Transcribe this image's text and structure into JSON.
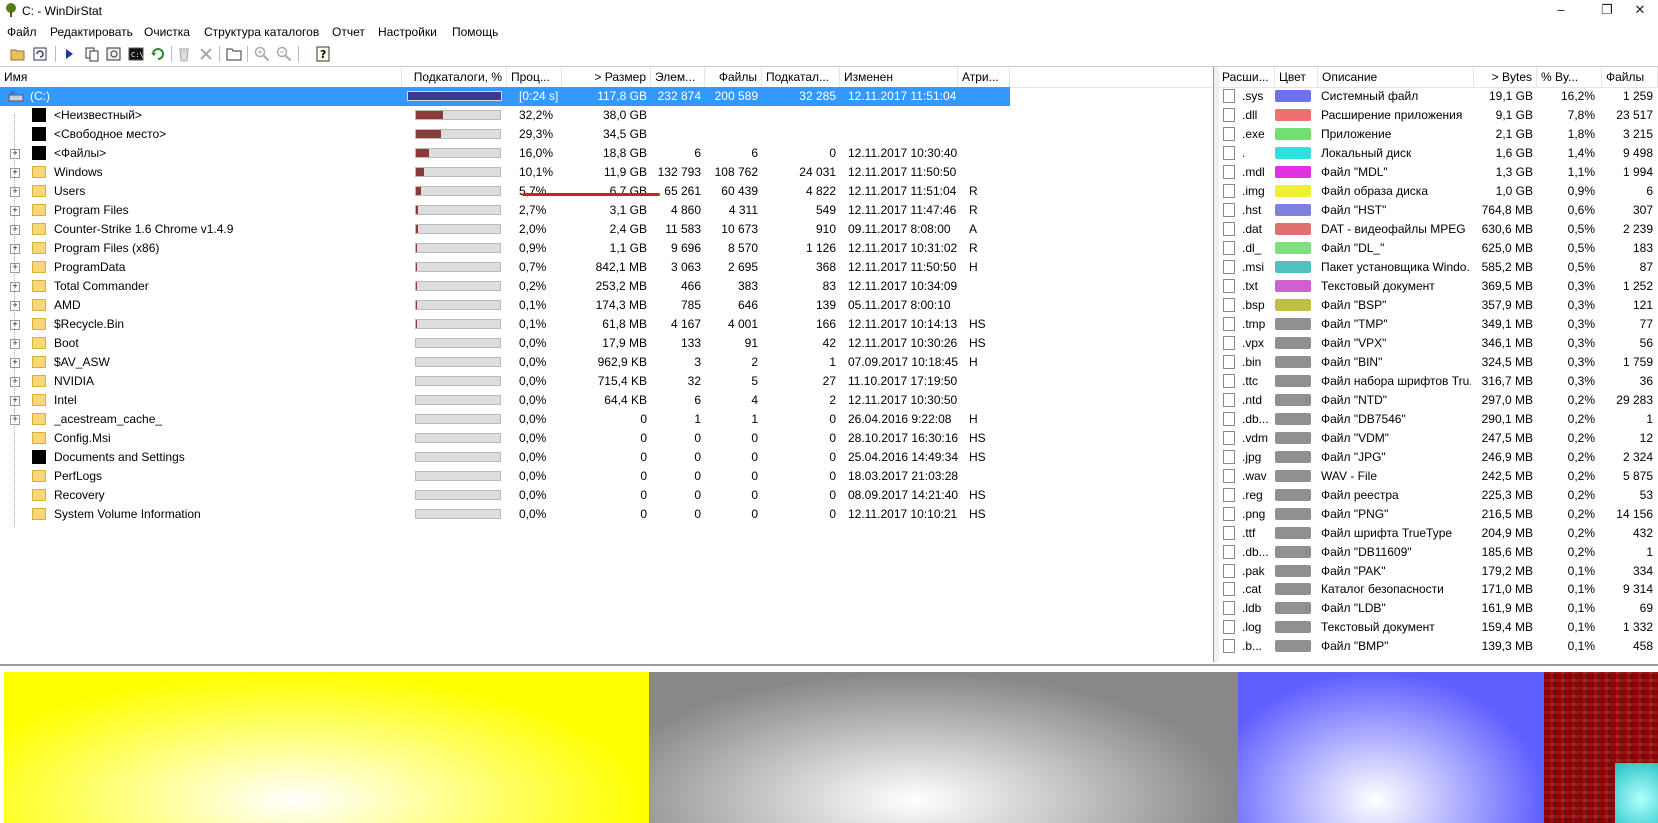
{
  "window": {
    "title": "C: - WinDirStat",
    "controls": [
      "–",
      "❐",
      "✕"
    ]
  },
  "menu": [
    "Файл",
    "Редактировать",
    "Очистка",
    "Структура каталогов",
    "Отчет",
    "Настройки",
    "Помощь"
  ],
  "toolbar": {
    "icons": [
      "open-icon",
      "refresh-icon",
      "play-icon",
      "copy-icon",
      "find-icon",
      "cmd-icon",
      "refresh-all-icon",
      "recycle-icon",
      "delete-icon",
      "folder-icon",
      "zoom-in-icon",
      "zoom-out-icon",
      "help-icon"
    ]
  },
  "tree": {
    "columns": [
      "Имя",
      "Подкаталоги, %",
      "Проц...",
      "> Размер",
      "Элем...",
      "Файлы",
      "Подкатал...",
      "Изменен",
      "Атри..."
    ],
    "rows": [
      {
        "name": "(C:)",
        "pct_bar": 1.0,
        "pct": "[0:24 s]",
        "size": "117,8 GB",
        "items": "232 874",
        "files": "200 589",
        "subdirs": "32 285",
        "modified": "12.11.2017  11:51:04",
        "attr": "",
        "icon": "drive",
        "expander": false,
        "selected": true
      },
      {
        "name": "<Неизвестный>",
        "pct_bar": 0.322,
        "pct": "32,2%",
        "size": "38,0 GB",
        "items": "",
        "files": "",
        "subdirs": "",
        "modified": "",
        "attr": "",
        "icon": "black",
        "expander": false
      },
      {
        "name": "<Свободное место>",
        "pct_bar": 0.293,
        "pct": "29,3%",
        "size": "34,5 GB",
        "items": "",
        "files": "",
        "subdirs": "",
        "modified": "",
        "attr": "",
        "icon": "black",
        "expander": false
      },
      {
        "name": "<Файлы>",
        "pct_bar": 0.16,
        "pct": "16,0%",
        "size": "18,8 GB",
        "items": "6",
        "files": "6",
        "subdirs": "0",
        "modified": "12.11.2017  10:30:40",
        "attr": "",
        "icon": "black",
        "expander": true
      },
      {
        "name": "Windows",
        "pct_bar": 0.101,
        "pct": "10,1%",
        "size": "11,9 GB",
        "items": "132 793",
        "files": "108 762",
        "subdirs": "24 031",
        "modified": "12.11.2017  11:50:50",
        "attr": "",
        "icon": "folder",
        "expander": true
      },
      {
        "name": "Users",
        "pct_bar": 0.057,
        "pct": "5,7%",
        "size": "6,7 GB",
        "items": "65 261",
        "files": "60 439",
        "subdirs": "4 822",
        "modified": "12.11.2017  11:51:04",
        "attr": "R",
        "icon": "folder",
        "expander": true
      },
      {
        "name": "Program Files",
        "pct_bar": 0.027,
        "pct": "2,7%",
        "size": "3,1 GB",
        "items": "4 860",
        "files": "4 311",
        "subdirs": "549",
        "modified": "12.11.2017  11:47:46",
        "attr": "R",
        "icon": "folder",
        "expander": true
      },
      {
        "name": "Counter-Strike 1.6 Chrome v1.4.9",
        "pct_bar": 0.02,
        "pct": "2,0%",
        "size": "2,4 GB",
        "items": "11 583",
        "files": "10 673",
        "subdirs": "910",
        "modified": "09.11.2017  8:08:00",
        "attr": "A",
        "icon": "folder",
        "expander": true
      },
      {
        "name": "Program Files (x86)",
        "pct_bar": 0.009,
        "pct": "0,9%",
        "size": "1,1 GB",
        "items": "9 696",
        "files": "8 570",
        "subdirs": "1 126",
        "modified": "12.11.2017  10:31:02",
        "attr": "R",
        "icon": "folder",
        "expander": true
      },
      {
        "name": "ProgramData",
        "pct_bar": 0.007,
        "pct": "0,7%",
        "size": "842,1 MB",
        "items": "3 063",
        "files": "2 695",
        "subdirs": "368",
        "modified": "12.11.2017  11:50:50",
        "attr": "H",
        "icon": "folder",
        "expander": true
      },
      {
        "name": "Total Commander",
        "pct_bar": 0.002,
        "pct": "0,2%",
        "size": "253,2 MB",
        "items": "466",
        "files": "383",
        "subdirs": "83",
        "modified": "12.11.2017  10:34:09",
        "attr": "",
        "icon": "folder",
        "expander": true
      },
      {
        "name": "AMD",
        "pct_bar": 0.001,
        "pct": "0,1%",
        "size": "174,3 MB",
        "items": "785",
        "files": "646",
        "subdirs": "139",
        "modified": "05.11.2017  8:00:10",
        "attr": "",
        "icon": "folder",
        "expander": true
      },
      {
        "name": "$Recycle.Bin",
        "pct_bar": 0.001,
        "pct": "0,1%",
        "size": "61,8 MB",
        "items": "4 167",
        "files": "4 001",
        "subdirs": "166",
        "modified": "12.11.2017  10:14:13",
        "attr": "HS",
        "icon": "folder",
        "expander": true
      },
      {
        "name": "Boot",
        "pct_bar": 0.0,
        "pct": "0,0%",
        "size": "17,9 MB",
        "items": "133",
        "files": "91",
        "subdirs": "42",
        "modified": "12.11.2017  10:30:26",
        "attr": "HS",
        "icon": "folder",
        "expander": true
      },
      {
        "name": "$AV_ASW",
        "pct_bar": 0.0,
        "pct": "0,0%",
        "size": "962,9 KB",
        "items": "3",
        "files": "2",
        "subdirs": "1",
        "modified": "07.09.2017  10:18:45",
        "attr": "H",
        "icon": "folder",
        "expander": true
      },
      {
        "name": "NVIDIA",
        "pct_bar": 0.0,
        "pct": "0,0%",
        "size": "715,4 KB",
        "items": "32",
        "files": "5",
        "subdirs": "27",
        "modified": "11.10.2017  17:19:50",
        "attr": "",
        "icon": "folder",
        "expander": true
      },
      {
        "name": "Intel",
        "pct_bar": 0.0,
        "pct": "0,0%",
        "size": "64,4 KB",
        "items": "6",
        "files": "4",
        "subdirs": "2",
        "modified": "12.11.2017  10:30:50",
        "attr": "",
        "icon": "folder",
        "expander": true
      },
      {
        "name": "_acestream_cache_",
        "pct_bar": 0.0,
        "pct": "0,0%",
        "size": "0",
        "items": "1",
        "files": "1",
        "subdirs": "0",
        "modified": "26.04.2016  9:22:08",
        "attr": "H",
        "icon": "folder",
        "expander": true
      },
      {
        "name": "Config.Msi",
        "pct_bar": 0.0,
        "pct": "0,0%",
        "size": "0",
        "items": "0",
        "files": "0",
        "subdirs": "0",
        "modified": "28.10.2017  16:30:16",
        "attr": "HS",
        "icon": "folder",
        "expander": false
      },
      {
        "name": "Documents and Settings",
        "pct_bar": 0.0,
        "pct": "0,0%",
        "size": "0",
        "items": "0",
        "files": "0",
        "subdirs": "0",
        "modified": "25.04.2016  14:49:34",
        "attr": "HS",
        "icon": "black",
        "expander": false
      },
      {
        "name": "PerfLogs",
        "pct_bar": 0.0,
        "pct": "0,0%",
        "size": "0",
        "items": "0",
        "files": "0",
        "subdirs": "0",
        "modified": "18.03.2017  21:03:28",
        "attr": "",
        "icon": "folder",
        "expander": false
      },
      {
        "name": "Recovery",
        "pct_bar": 0.0,
        "pct": "0,0%",
        "size": "0",
        "items": "0",
        "files": "0",
        "subdirs": "0",
        "modified": "08.09.2017  14:21:40",
        "attr": "HS",
        "icon": "folder",
        "expander": false
      },
      {
        "name": "System Volume Information",
        "pct_bar": 0.0,
        "pct": "0,0%",
        "size": "0",
        "items": "0",
        "files": "0",
        "subdirs": "0",
        "modified": "12.11.2017  10:10:21",
        "attr": "HS",
        "icon": "folder",
        "expander": false
      }
    ]
  },
  "extensions": {
    "columns": [
      "Расши...",
      "Цвет",
      "Описание",
      "> Bytes",
      "% By...",
      "Файлы"
    ],
    "rows": [
      {
        "ext": ".sys",
        "color": "#7070f0",
        "desc": "Системный файл",
        "bytes": "19,1 GB",
        "pct": "16,2%",
        "files": "1 259"
      },
      {
        "ext": ".dll",
        "color": "#f07070",
        "desc": "Расширение приложения",
        "bytes": "9,1 GB",
        "pct": "7,8%",
        "files": "23 517"
      },
      {
        "ext": ".exe",
        "color": "#70e070",
        "desc": "Приложение",
        "bytes": "2,1 GB",
        "pct": "1,8%",
        "files": "3 215"
      },
      {
        "ext": ".",
        "color": "#30e0e0",
        "desc": "Локальный диск",
        "bytes": "1,6 GB",
        "pct": "1,4%",
        "files": "9 498"
      },
      {
        "ext": ".mdl",
        "color": "#e030e0",
        "desc": "Файл \"MDL\"",
        "bytes": "1,3 GB",
        "pct": "1,1%",
        "files": "1 994"
      },
      {
        "ext": ".img",
        "color": "#f0f030",
        "desc": "Файл образа диска",
        "bytes": "1,0 GB",
        "pct": "0,9%",
        "files": "6"
      },
      {
        "ext": ".hst",
        "color": "#8080e0",
        "desc": "Файл \"HST\"",
        "bytes": "764,8 MB",
        "pct": "0,6%",
        "files": "307"
      },
      {
        "ext": ".dat",
        "color": "#e07070",
        "desc": "DAT - видеофайлы MPEG",
        "bytes": "630,6 MB",
        "pct": "0,5%",
        "files": "2 239"
      },
      {
        "ext": ".dl_",
        "color": "#80e080",
        "desc": "Файл \"DL_\"",
        "bytes": "625,0 MB",
        "pct": "0,5%",
        "files": "183"
      },
      {
        "ext": ".msi",
        "color": "#50c0c0",
        "desc": "Пакет установщика Windo...",
        "bytes": "585,2 MB",
        "pct": "0,5%",
        "files": "87"
      },
      {
        "ext": ".txt",
        "color": "#d060d0",
        "desc": "Текстовый документ",
        "bytes": "369,5 MB",
        "pct": "0,3%",
        "files": "1 252"
      },
      {
        "ext": ".bsp",
        "color": "#c0c040",
        "desc": "Файл \"BSP\"",
        "bytes": "357,9 MB",
        "pct": "0,3%",
        "files": "121"
      },
      {
        "ext": ".tmp",
        "color": "#909090",
        "desc": "Файл \"TMP\"",
        "bytes": "349,1 MB",
        "pct": "0,3%",
        "files": "77"
      },
      {
        "ext": ".vpx",
        "color": "#909090",
        "desc": "Файл \"VPX\"",
        "bytes": "346,1 MB",
        "pct": "0,3%",
        "files": "56"
      },
      {
        "ext": ".bin",
        "color": "#909090",
        "desc": "Файл \"BIN\"",
        "bytes": "324,5 MB",
        "pct": "0,3%",
        "files": "1 759"
      },
      {
        "ext": ".ttc",
        "color": "#909090",
        "desc": "Файл набора шрифтов Tru...",
        "bytes": "316,7 MB",
        "pct": "0,3%",
        "files": "36"
      },
      {
        "ext": ".ntd",
        "color": "#909090",
        "desc": "Файл \"NTD\"",
        "bytes": "297,0 MB",
        "pct": "0,2%",
        "files": "29 283"
      },
      {
        "ext": ".db...",
        "color": "#909090",
        "desc": "Файл \"DB7546\"",
        "bytes": "290,1 MB",
        "pct": "0,2%",
        "files": "1"
      },
      {
        "ext": ".vdm",
        "color": "#909090",
        "desc": "Файл \"VDM\"",
        "bytes": "247,5 MB",
        "pct": "0,2%",
        "files": "12"
      },
      {
        "ext": ".jpg",
        "color": "#909090",
        "desc": "Файл \"JPG\"",
        "bytes": "246,9 MB",
        "pct": "0,2%",
        "files": "2 324"
      },
      {
        "ext": ".wav",
        "color": "#909090",
        "desc": "WAV - File",
        "bytes": "242,5 MB",
        "pct": "0,2%",
        "files": "5 875"
      },
      {
        "ext": ".reg",
        "color": "#909090",
        "desc": "Файл реестра",
        "bytes": "225,3 MB",
        "pct": "0,2%",
        "files": "53"
      },
      {
        "ext": ".png",
        "color": "#909090",
        "desc": "Файл \"PNG\"",
        "bytes": "216,5 MB",
        "pct": "0,2%",
        "files": "14 156"
      },
      {
        "ext": ".ttf",
        "color": "#909090",
        "desc": "Файл шрифта TrueType",
        "bytes": "204,9 MB",
        "pct": "0,2%",
        "files": "432"
      },
      {
        "ext": ".db...",
        "color": "#909090",
        "desc": "Файл \"DB11609\"",
        "bytes": "185,6 MB",
        "pct": "0,2%",
        "files": "1"
      },
      {
        "ext": ".pak",
        "color": "#909090",
        "desc": "Файл \"PAK\"",
        "bytes": "179,2 MB",
        "pct": "0,1%",
        "files": "334"
      },
      {
        "ext": ".cat",
        "color": "#909090",
        "desc": "Каталог безопасности",
        "bytes": "171,0 MB",
        "pct": "0,1%",
        "files": "9 314"
      },
      {
        "ext": ".ldb",
        "color": "#909090",
        "desc": "Файл \"LDB\"",
        "bytes": "161,9 MB",
        "pct": "0,1%",
        "files": "69"
      },
      {
        "ext": ".log",
        "color": "#909090",
        "desc": "Текстовый документ",
        "bytes": "159,4 MB",
        "pct": "0,1%",
        "files": "1 332"
      },
      {
        "ext": ".b...",
        "color": "#909090",
        "desc": "Файл \"BMP\"",
        "bytes": "139,3 MB",
        "pct": "0,1%",
        "files": "458"
      }
    ]
  },
  "treemap": {
    "blocks": [
      {
        "name": "img-block",
        "color": "#ffff00",
        "share": 0.39
      },
      {
        "name": "unknown-block",
        "color": "#888888",
        "share": 0.356
      },
      {
        "name": "sys-block",
        "color": "#6060ff",
        "share": 0.185
      },
      {
        "name": "mixed-block",
        "color": "#d04040",
        "share": 0.069
      }
    ]
  }
}
